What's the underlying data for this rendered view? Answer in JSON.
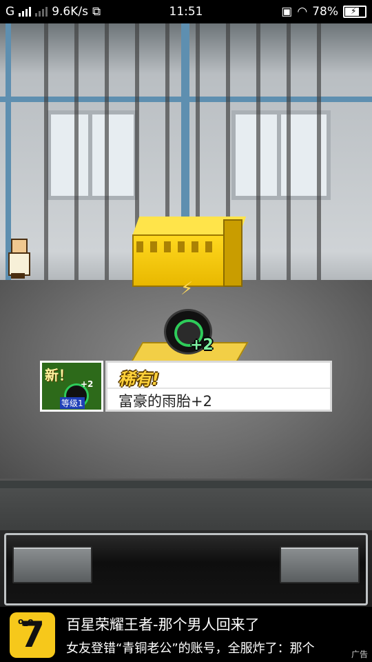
{
  "status_bar": {
    "carrier": "G",
    "net_speed": "9.6K/s",
    "time": "11:51",
    "battery": "78%",
    "battery_level": 0.78
  },
  "scene": {
    "notice": {
      "new_label": "新！",
      "rarity": "稀有!",
      "item_name": "富豪的雨胎+2",
      "icon_level": "等级1",
      "icon_plus": "+2"
    },
    "item_plus": "+2"
  },
  "controls": {
    "left_button": "",
    "right_button": ""
  },
  "ad": {
    "title": "百星荣耀王者-那个男人回来了",
    "description": "女友登错“青铜老公”的账号，全服炸了：那个",
    "mark": "广告",
    "logo_text": "7"
  },
  "colors": {
    "accent_gold": "#ffd23a",
    "tire_green": "#2ecc5a",
    "ad_logo": "#f6c81b"
  }
}
